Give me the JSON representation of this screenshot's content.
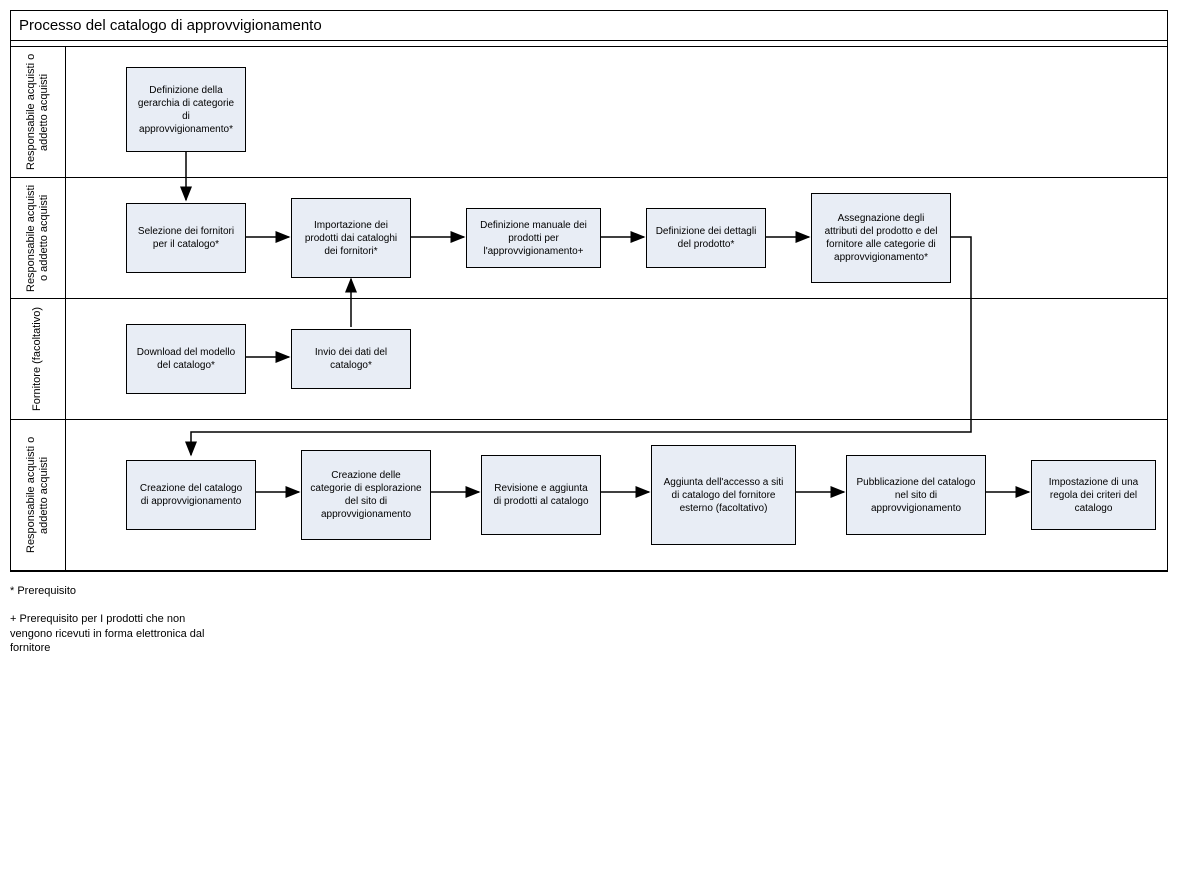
{
  "title": "Processo del catalogo di approvvigionamento",
  "lanes": {
    "l0": "Responsabile acquisti o addetto acquisti",
    "l1": "Responsabile acquisti o addetto acquisti",
    "l2": "Fornitore (facoltativo)",
    "l3": "Responsabile acquisti o addetto acquisti"
  },
  "boxes": {
    "b00": "Definizione della gerarchia di categorie di approvvigionamento*",
    "b10": "Selezione dei fornitori per il catalogo*",
    "b11": "Importazione dei prodotti dai cataloghi dei fornitori*",
    "b12": "Definizione manuale dei prodotti per l'approvvigionamento+",
    "b13": "Definizione dei dettagli del prodotto*",
    "b14": "Assegnazione degli attributi del prodotto e del fornitore alle categorie di approvvigionamento*",
    "b20": "Download del modello del catalogo*",
    "b21": "Invio dei dati del catalogo*",
    "b30": "Creazione del catalogo di approvvigionamento",
    "b31": "Creazione delle categorie di esplorazione del sito di approvvigionamento",
    "b32": "Revisione e aggiunta di prodotti al catalogo",
    "b33": "Aggiunta dell'accesso a siti di catalogo del fornitore esterno (facoltativo)",
    "b34": "Pubblicazione del catalogo nel sito di approvvigionamento",
    "b35": "Impostazione di una regola dei criteri del catalogo"
  },
  "footnotes": {
    "f1": "* Prerequisito",
    "f2": "+ Prerequisito per I prodotti che non vengono ricevuti in forma elettronica dal fornitore"
  }
}
